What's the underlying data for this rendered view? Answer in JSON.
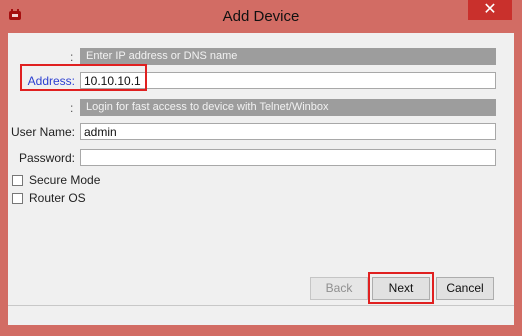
{
  "window": {
    "title": "Add Device",
    "close_glyph": "✕",
    "icon": "mikrotik-app-icon"
  },
  "form": {
    "section1": {
      "colon": ":",
      "bar_text": "Enter IP address or DNS name"
    },
    "address": {
      "label": "Address:",
      "value": "10.10.10.1"
    },
    "section2": {
      "colon": ":",
      "bar_text": "Login for fast access to device with Telnet/Winbox"
    },
    "username": {
      "label": "User Name:",
      "value": "admin"
    },
    "password": {
      "label": "Password:",
      "value": ""
    },
    "secure_mode": {
      "label": "Secure Mode",
      "checked": false
    },
    "router_os": {
      "label": "Router OS",
      "checked": false
    }
  },
  "buttons": {
    "back": "Back",
    "next": "Next",
    "cancel": "Cancel"
  },
  "colors": {
    "title_bar": "#d26c64",
    "close_button": "#c9302c",
    "address_label": "#2b3fd1",
    "highlight_box": "#e02020",
    "section_bar": "#9d9d9d"
  }
}
